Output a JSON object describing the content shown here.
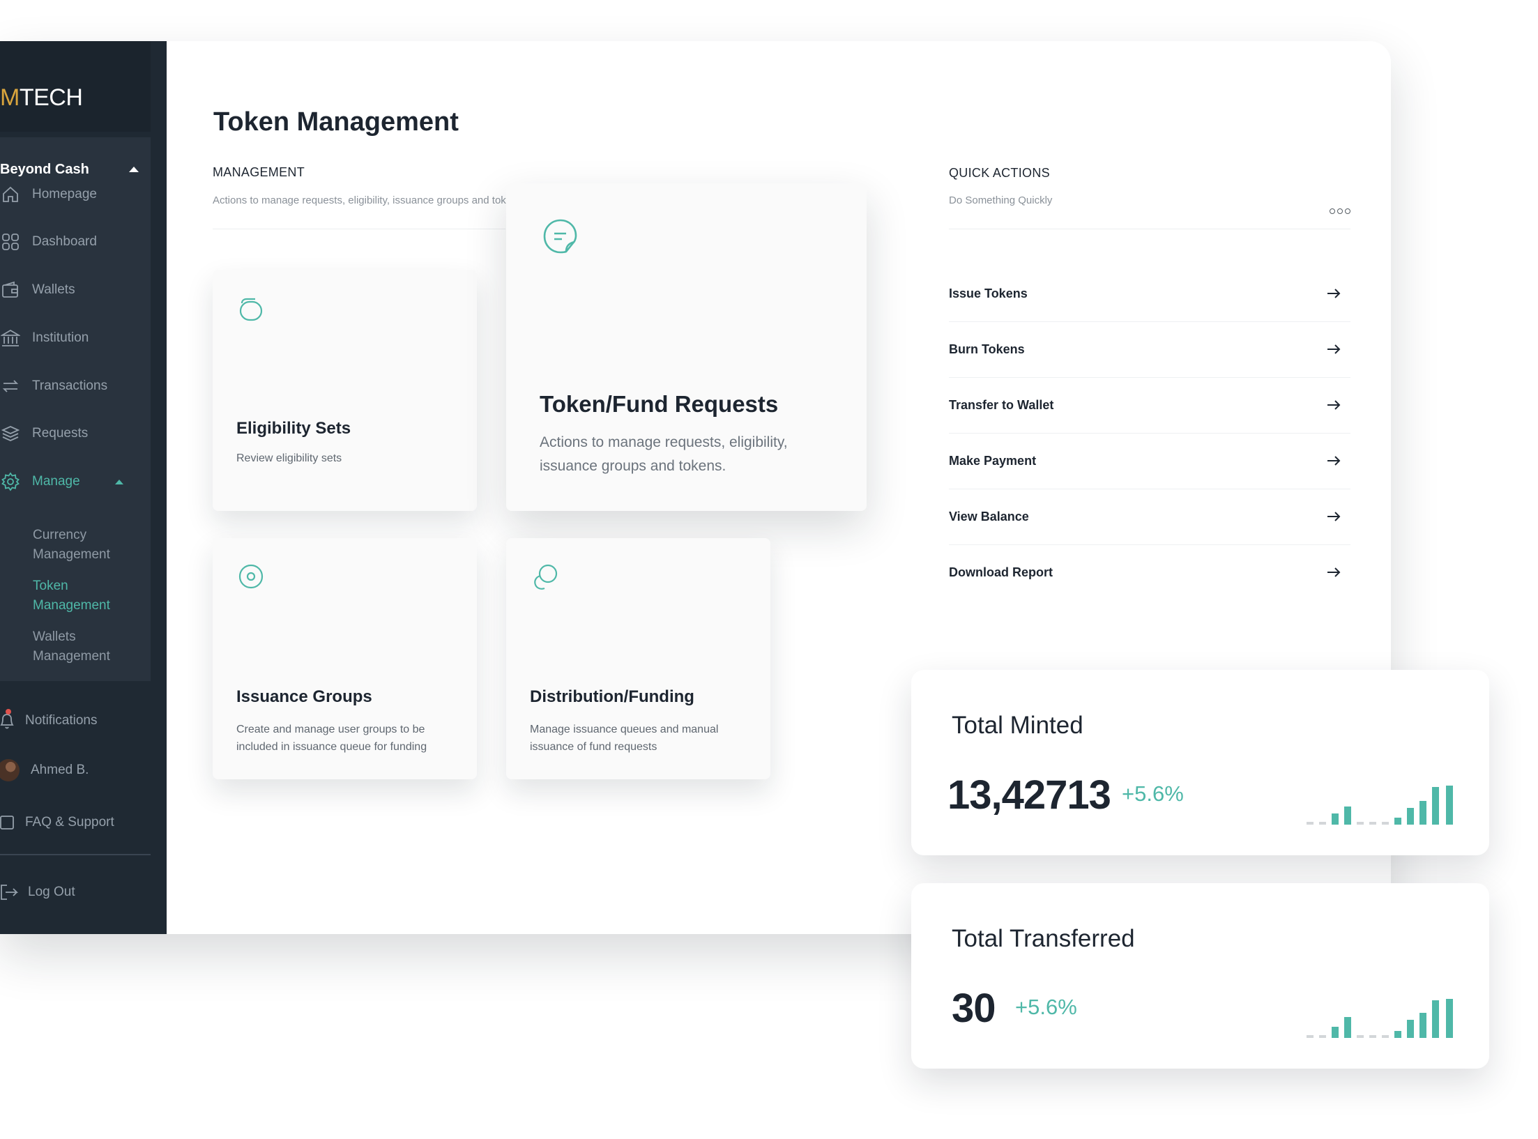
{
  "sidebar": {
    "logo_accent": "M",
    "logo_rest": "TECH",
    "group_title": "Beyond Cash",
    "items": [
      {
        "label": "Homepage",
        "icon": "home-icon"
      },
      {
        "label": "Dashboard",
        "icon": "grid-icon"
      },
      {
        "label": "Wallets",
        "icon": "wallet-icon"
      },
      {
        "label": "Institution",
        "icon": "bank-icon"
      },
      {
        "label": "Transactions",
        "icon": "swap-icon"
      },
      {
        "label": "Requests",
        "icon": "layers-icon"
      },
      {
        "label": "Manage",
        "icon": "gear-icon"
      }
    ],
    "manage_sub": [
      {
        "line1": "Currency",
        "line2": "Management"
      },
      {
        "line1": "Token",
        "line2": "Management"
      },
      {
        "line1": "Wallets",
        "line2": "Management"
      }
    ],
    "bottom": {
      "notifications": "Notifications",
      "user": "Ahmed B.",
      "faq": "FAQ & Support",
      "logout": "Log Out"
    }
  },
  "main": {
    "title": "Token Management",
    "management": {
      "label": "MANAGEMENT",
      "subtitle": "Actions to manage requests, eligibility, issuance groups and tokens."
    },
    "cards": {
      "eligibility": {
        "title": "Eligibility Sets",
        "desc": "Review eligibility sets"
      },
      "requests": {
        "title": "Token/Fund Requests",
        "desc_line1": "Actions to manage requests, eligibility,",
        "desc_line2": "issuance groups and tokens."
      },
      "issuance": {
        "title": "Issuance Groups",
        "desc_line1": "Create and manage user groups to be",
        "desc_line2": "included in issuance queue for funding"
      },
      "distribution": {
        "title": "Distribution/Funding",
        "desc_line1": "Manage issuance queues and manual",
        "desc_line2": "issuance of fund requests"
      }
    },
    "quick_actions": {
      "label": "QUICK ACTIONS",
      "subtitle": "Do Something Quickly",
      "items": [
        "Issue Tokens",
        "Burn Tokens",
        "Transfer to Wallet",
        "Make Payment",
        "View Balance",
        "Download Report"
      ]
    }
  },
  "stats": {
    "minted": {
      "title": "Total Minted",
      "value": "13,42713",
      "delta": "+5.6%"
    },
    "transferred": {
      "title": "Total Transferred",
      "value": "30",
      "delta": "+5.6%"
    }
  },
  "colors": {
    "accent": "#4fb8a8",
    "sidebar_bg": "#1f2933",
    "logo_accent": "#d9a53d"
  }
}
